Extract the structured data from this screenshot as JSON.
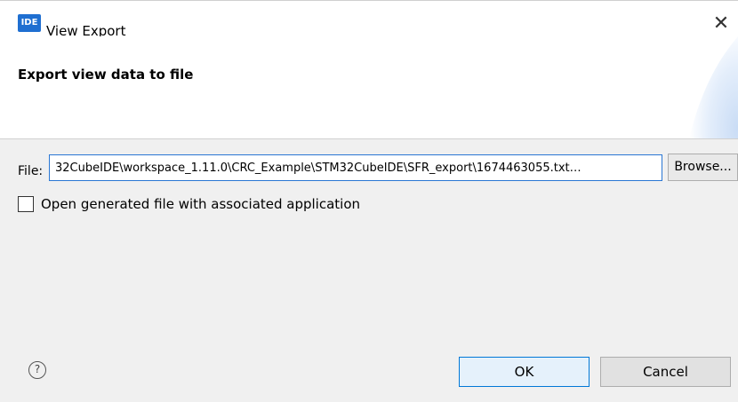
{
  "window": {
    "app_icon_text": "IDE",
    "title": "View Export",
    "close_symbol": "✕"
  },
  "banner": {
    "title": "Export view data to file"
  },
  "file": {
    "label": "File:",
    "value": "…32CubeIDE\\workspace_1.11.0\\CRC_Example\\STM32CubeIDE\\SFR_export\\1674463055.txt",
    "browse_label": "Browse..."
  },
  "option": {
    "label": "Open generated file with associated application",
    "checked": false
  },
  "footer": {
    "help_symbol": "?",
    "ok_label": "OK",
    "cancel_label": "Cancel"
  },
  "colors": {
    "accent": "#0078d7",
    "icon_bg": "#1f6fd1",
    "dialog_bg": "#f0f0f0"
  }
}
